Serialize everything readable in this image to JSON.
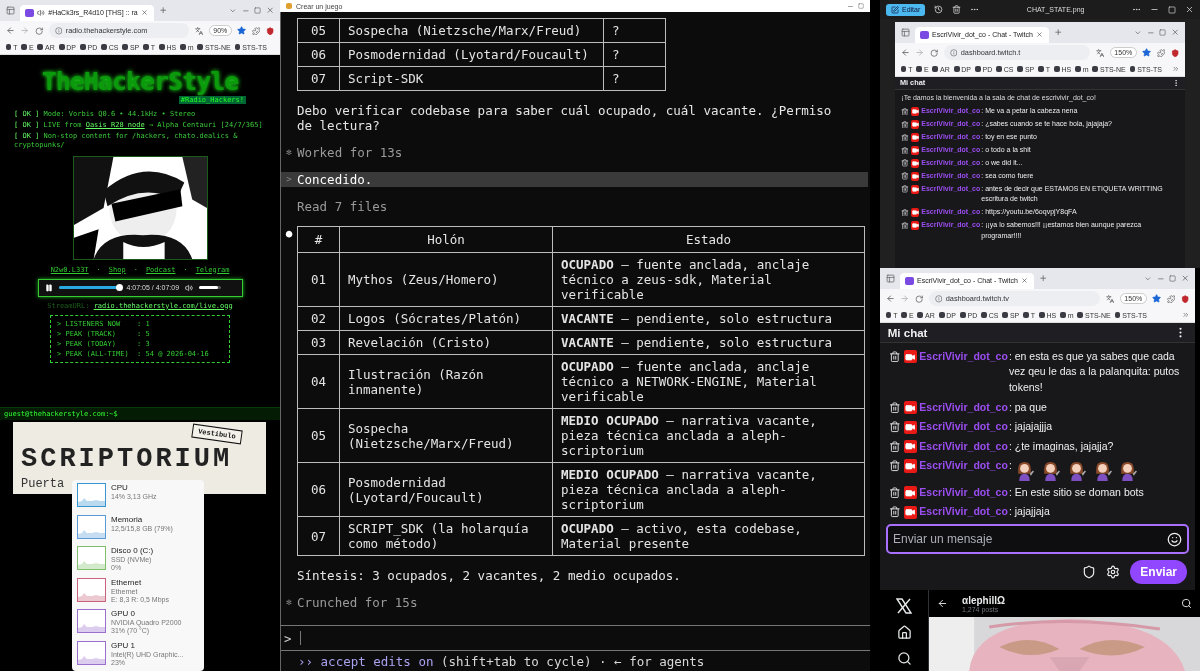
{
  "radio_browser": {
    "tab_title": "#HaCk3rs_R4d10 [THS] :: ra",
    "url": "radio.thehackerstyle.com",
    "zoom": "90%",
    "bookmarks": [
      {
        "label": "T"
      },
      {
        "label": "E"
      },
      {
        "label": "AR"
      },
      {
        "label": "DP"
      },
      {
        "label": "PD"
      },
      {
        "label": "CS"
      },
      {
        "label": "SP"
      },
      {
        "label": "T"
      },
      {
        "label": "HS"
      },
      {
        "label": "m"
      },
      {
        "label": "STS-NE"
      },
      {
        "label": "STS-TS"
      }
    ],
    "page": {
      "logo": "TheHackerStyle",
      "tagline": "#Radio_Hackers!",
      "status_lines": [
        {
          "tag": "[ OK ]",
          "before": "Mode: Vorbis Q0.6 • 44.1kHz • Stereo"
        },
        {
          "tag": "[ OK ]",
          "before": "LIVE from ",
          "link": "Oasis R28 node",
          "after": " → Alpha Centauri [24/7/365]"
        },
        {
          "tag": "[ OK ]",
          "before": "Non-stop content for /hackers, chato.dealics & cryptopunks/"
        }
      ],
      "picture": {
        "kind": "picture"
      },
      "links": [
        "N2w0.L33T",
        "Shop",
        "Podcast",
        "Telegram"
      ],
      "link_separator": "·",
      "player": {
        "playing": true,
        "time": "4:07:05 / 4:07:09",
        "level": 0.98,
        "volume": {
          "level": 0.85
        }
      },
      "stream": {
        "label": "StreamURL:",
        "url": "radio.thehackerstyle.com/live.ogg"
      },
      "stats": [
        "> LISTENERS NOW    : 1",
        "> PEAK (TRACK)     : 5",
        "> PEAK (TODAY)     : 3",
        "> PEAK (ALL-TIME)  : 54 @ 2026-04-16"
      ],
      "terminal_prompt": "guest@thehackerstyle.com:~$"
    }
  },
  "scriptorium": {
    "title": "SCRIPTORIUM",
    "stamp": "Vestibulo",
    "subtitle": "Puerta"
  },
  "task_manager": {
    "items": [
      {
        "name": "CPU",
        "details": [
          "14% 3,13 GHz"
        ],
        "color": "#3a96d0"
      },
      {
        "name": "Memoria",
        "details": [
          "12,5/15,8 GB (79%)"
        ],
        "color": "#5a9ad6"
      },
      {
        "name": "Disco 0 (C:)",
        "details": [
          "SSD (NVMe)",
          "0%"
        ],
        "color": "#7fbf6a"
      },
      {
        "name": "Ethernet",
        "details": [
          "Ethernet",
          "E: 8,3 R: 0,5 Mbps"
        ],
        "color": "#c9627a"
      },
      {
        "name": "GPU 0",
        "details": [
          "NVIDIA Quadro P2000",
          "31% (70 °C)"
        ],
        "color": "#9b6fd0"
      },
      {
        "name": "GPU 1",
        "details": [
          "Intel(R) UHD Graphic...",
          "23%"
        ],
        "color": "#9b6fd0"
      }
    ]
  },
  "terminal": {
    "title": "Crear un juego",
    "transcript": [
      {
        "kind": "table",
        "rows": [
          [
            "05",
            "Sospecha (Nietzsche/Marx/Freud)",
            "?"
          ],
          [
            "06",
            "Posmodernidad (Lyotard/Foucault)",
            "?"
          ],
          [
            "07",
            "Script-SDK",
            "?"
          ]
        ]
      },
      {
        "kind": "text",
        "text": "Debo verificar codebase para saber cuál ocupado, cuál vacante. ¿Permiso de lectura?"
      },
      {
        "kind": "status",
        "bullet": "✻",
        "text": "Worked for 13s"
      },
      {
        "kind": "user",
        "bullet": ">",
        "text": "Concedido."
      },
      {
        "kind": "note",
        "text": "Read 7 files"
      },
      {
        "kind": "table",
        "bullet": "●",
        "columns": [
          "#",
          "Holón",
          "Estado"
        ],
        "rows": [
          [
            "01",
            "Mythos (Zeus/Homero)",
            "**OCUPADO** – fuente anclada, anclaje técnico a zeus-sdk, Material verificable"
          ],
          [
            "02",
            "Logos (Sócrates/Platón)",
            "**VACANTE** – pendiente, solo estructura"
          ],
          [
            "03",
            "Revelación (Cristo)",
            "**VACANTE** – pendiente, solo estructura"
          ],
          [
            "04",
            "Ilustración (Razón inmanente)",
            "**OCUPADO** – fuente anclada, anclaje técnico a NETWORK-ENGINE, Material verificable"
          ],
          [
            "05",
            "Sospecha (Nietzsche/Marx/Freud)",
            "**MEDIO OCUPADO** – narrativa vacante, pieza técnica anclada a aleph-scriptorium"
          ],
          [
            "06",
            "Posmodernidad (Lyotard/Foucault)",
            "**MEDIO OCUPADO** – narrativa vacante, pieza técnica anclada a aleph-scriptorium"
          ],
          [
            "07",
            "SCRIPT_SDK (la holarquía como método)",
            "**OCUPADO** – activo, esta codebase, Material presente"
          ]
        ]
      },
      {
        "kind": "text",
        "text": "Síntesis: 3 ocupados, 2 vacantes, 2 medio ocupados."
      },
      {
        "kind": "status",
        "bullet": "✻",
        "text": "Crunched for 15s"
      }
    ],
    "prompt": ">",
    "mode": "›› accept edits on",
    "hint": "(shift+tab to cycle) · ← for agents"
  },
  "image_viewer": {
    "edit_button": "Editar",
    "filename": "CHAT_STATE.png",
    "screenshot": {
      "browser": {
        "tab_title": "EscriVivir_dot_co - Chat - Twitch",
        "url": "dashboard.twitch.t",
        "zoom": "150%",
        "bookmarks": [
          {
            "label": "T"
          },
          {
            "label": "E"
          },
          {
            "label": "AR"
          },
          {
            "label": "DP"
          },
          {
            "label": "PD"
          },
          {
            "label": "CS"
          },
          {
            "label": "SP"
          },
          {
            "label": "T"
          },
          {
            "label": "HS"
          },
          {
            "label": "m"
          },
          {
            "label": "STS-NE"
          },
          {
            "label": "STS-TS"
          }
        ]
      },
      "chat_title": "Mi chat",
      "welcome": "¡Te damos la bienvenida a la sala de chat de escrivivir_dot_co!",
      "separator": ": ",
      "messages": [
        {
          "kind": "text",
          "user": "EscriVivir_dot_co",
          "text": "Me va a petar la cabeza nena"
        },
        {
          "kind": "text",
          "user": "EscriVivir_dot_co",
          "text": "¿sabes cuando se te hace bola, jajajaja?"
        },
        {
          "kind": "text",
          "user": "EscriVivir_dot_co",
          "text": "toy en ese punto"
        },
        {
          "kind": "text",
          "user": "EscriVivir_dot_co",
          "text": "o todo a la shit"
        },
        {
          "kind": "text",
          "user": "EscriVivir_dot_co",
          "text": "o we did it..."
        },
        {
          "kind": "text",
          "user": "EscriVivir_dot_co",
          "text": "sea como fuere"
        },
        {
          "kind": "text",
          "user": "EscriVivir_dot_co",
          "text": "antes de decir que ESTAMOS EN ETIQUETA WRITTING escritura de twitch"
        },
        {
          "kind": "text",
          "user": "EscriVivir_dot_co",
          "text": "https://youtu.be/6oqvpjY8qFA"
        },
        {
          "kind": "text",
          "user": "EscriVivir_dot_co",
          "text": "¡¡ya lo sabemos!!! ¡¡estamos bien aunque parezca programar!!!!"
        }
      ]
    }
  },
  "chat_window": {
    "browser": {
      "tab_title": "EscriVivir_dot_co - Chat - Twitch",
      "url": "dashboard.twitch.tv",
      "zoom": "150%",
      "bookmarks": [
        {
          "label": "T"
        },
        {
          "label": "E"
        },
        {
          "label": "AR"
        },
        {
          "label": "DP"
        },
        {
          "label": "PD"
        },
        {
          "label": "CS"
        },
        {
          "label": "SP"
        },
        {
          "label": "T"
        },
        {
          "label": "HS"
        },
        {
          "label": "m"
        },
        {
          "label": "STS-NE"
        },
        {
          "label": "STS-TS"
        }
      ]
    },
    "chat_title": "Mi chat",
    "separator": ": ",
    "messages": [
      {
        "kind": "text",
        "user": "EscriVivir_dot_co",
        "text": "en esta es que ya sabes que cada vez qeu le das a la palanquita: putos tokens!"
      },
      {
        "kind": "text",
        "user": "EscriVivir_dot_co",
        "text": "pa que"
      },
      {
        "kind": "text",
        "user": "EscriVivir_dot_co",
        "text": "jajajajjja"
      },
      {
        "kind": "text",
        "user": "EscriVivir_dot_co",
        "text": "¿te imaginas, jajajja?"
      },
      {
        "kind": "emotes",
        "user": "EscriVivir_dot_co",
        "emotes": [
          {
            "kind": "emote"
          },
          {
            "kind": "emote"
          },
          {
            "kind": "emote"
          },
          {
            "kind": "emote"
          },
          {
            "kind": "emote"
          }
        ]
      },
      {
        "kind": "text",
        "user": "EscriVivir_dot_co",
        "text": "En este sitio se doman bots"
      },
      {
        "kind": "text",
        "user": "EscriVivir_dot_co",
        "text": "jajajjaja"
      }
    ],
    "input": {
      "placeholder": "Enviar un mensaje"
    },
    "send_button": "Enviar"
  },
  "x_profile": {
    "name": "αlephillΩ",
    "posts": "1,274 posts",
    "photo": {
      "kind": "picture"
    }
  }
}
